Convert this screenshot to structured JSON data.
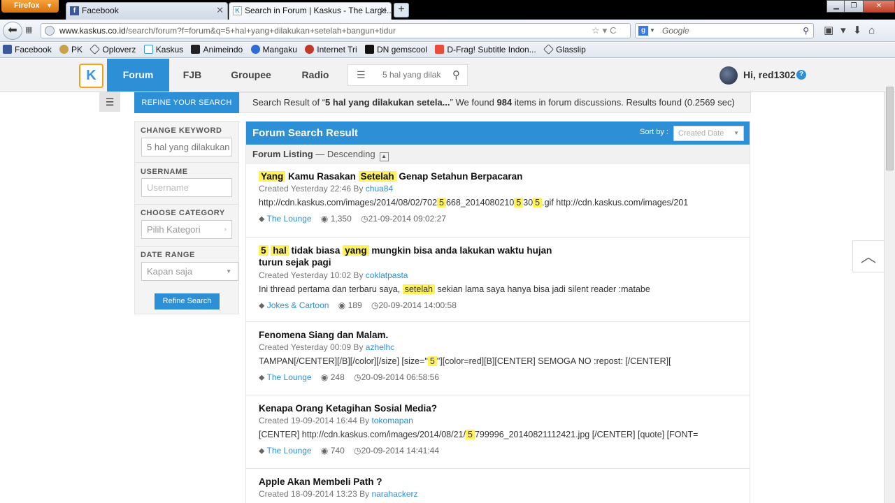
{
  "browser": {
    "app_button": "Firefox",
    "tabs": [
      {
        "label": "Facebook",
        "active": false
      },
      {
        "label": "Search in Forum | Kaskus - The Large...",
        "active": true
      }
    ],
    "new_tab": "+",
    "address": {
      "domain": "www.kaskus.co.id",
      "path": "/search/forum?f=forum&q=5+hal+yang+dilakukan+setelah+bangun+tidur"
    },
    "search_placeholder": "Google",
    "bookmarks": [
      {
        "label": "Facebook",
        "color": "#3b5998"
      },
      {
        "label": "PK",
        "color": "#c8a24a"
      },
      {
        "label": "Oploverz",
        "color": "#ffffff"
      },
      {
        "label": "Kaskus",
        "color": "#3a9ad9"
      },
      {
        "label": "Animeindo",
        "color": "#222222"
      },
      {
        "label": "Mangaku",
        "color": "#2d6bd6"
      },
      {
        "label": "Internet Tri",
        "color": "#c0392b"
      },
      {
        "label": "DN gemscool",
        "color": "#111111"
      },
      {
        "label": "D-Frag! Subtitle Indon...",
        "color": "#e74c3c"
      },
      {
        "label": "Glasslip",
        "color": "#ffffff"
      }
    ]
  },
  "site": {
    "logo": "K",
    "nav": [
      "Forum",
      "FJB",
      "Groupee",
      "Radio"
    ],
    "search_value": "5 hal yang dilak",
    "greeting": "Hi, red1302",
    "help": "?",
    "accent": "#2d8fd5"
  },
  "page": {
    "refine_tab": "REFINE YOUR SEARCH",
    "summary": {
      "pre": "Search Result of “",
      "query": "5 hal yang dilakukan setela...",
      "mid": "” We found ",
      "count": "984",
      "post": " items in forum discussions. Results found (0.2569 sec)"
    },
    "sidebar": {
      "keyword_title": "CHANGE KEYWORD",
      "keyword_value": "5 hal yang dilakukan",
      "username_title": "USERNAME",
      "username_placeholder": "Username",
      "category_title": "CHOOSE CATEGORY",
      "category_value": "Pilih Kategori",
      "date_title": "DATE RANGE",
      "date_value": "Kapan saja",
      "button": "Refine Search"
    },
    "results_title": "Forum Search Result",
    "sort_label": "Sort by :",
    "sort_value": "Created Date",
    "listing_label": "Forum Listing",
    "listing_order": "— Descending",
    "results": [
      {
        "title_parts": [
          [
            "Yang",
            true
          ],
          [
            " Kamu Rasakan ",
            false
          ],
          [
            "Setelah",
            true
          ],
          [
            " Genap Setahun Berpacaran",
            false
          ]
        ],
        "created": "Created Yesterday 22:46 By ",
        "author": "chua84",
        "snippet_parts": [
          [
            "http://cdn.kaskus.com/images/2014/08/02/702",
            false
          ],
          [
            "5",
            true
          ],
          [
            "668_2014080210",
            false
          ],
          [
            "5",
            true
          ],
          [
            "30",
            false
          ],
          [
            "5",
            true
          ],
          [
            ".gif http://cdn.kaskus.com/images/201",
            false
          ]
        ],
        "category": "The Lounge",
        "views": "1,350",
        "date": "21-09-2014 09:02:27"
      },
      {
        "title_parts": [
          [
            "5",
            true
          ],
          [
            " ",
            false
          ],
          [
            "hal",
            true
          ],
          [
            " tidak biasa ",
            false
          ],
          [
            "yang",
            true
          ],
          [
            " mungkin bisa anda lakukan waktu hujan turun sejak pagi",
            false
          ]
        ],
        "created": "Created Yesterday 10:02 By ",
        "author": "coklatpasta",
        "snippet_parts": [
          [
            "Ini thread pertama dan terbaru saya, ",
            false
          ],
          [
            "setelah",
            true
          ],
          [
            " sekian lama saya hanya bisa jadi silent reader :matabe",
            false
          ]
        ],
        "category": "Jokes & Cartoon",
        "views": "189",
        "date": "20-09-2014 14:00:58"
      },
      {
        "title_parts": [
          [
            "Fenomena Siang dan Malam.",
            false
          ]
        ],
        "created": "Created Yesterday 00:09 By ",
        "author": "azhelhc",
        "snippet_parts": [
          [
            "TAMPAN[/CENTER][/B][/color][/size] [size=\"",
            false
          ],
          [
            "5",
            true
          ],
          [
            "\"][color=red][B][CENTER] SEMOGA NO :repost: [/CENTER][",
            false
          ]
        ],
        "category": "The Lounge",
        "views": "248",
        "date": "20-09-2014 06:58:56"
      },
      {
        "title_parts": [
          [
            "Kenapa Orang Ketagihan Sosial Media?",
            false
          ]
        ],
        "created": "Created 19-09-2014 16:44 By ",
        "author": "tokomapan",
        "snippet_parts": [
          [
            "[CENTER] http://cdn.kaskus.com/images/2014/08/21/",
            false
          ],
          [
            "5",
            true
          ],
          [
            "799996_20140821112421.jpg [/CENTER] [quote] [FONT=",
            false
          ]
        ],
        "category": "The Lounge",
        "views": "740",
        "date": "20-09-2014 14:41:44"
      },
      {
        "title_parts": [
          [
            "Apple Akan Membeli Path ?",
            false
          ]
        ],
        "created": "Created 18-09-2014 13:23 By ",
        "author": "narahackerz",
        "snippet_parts": [],
        "category": "",
        "views": "",
        "date": ""
      }
    ]
  }
}
